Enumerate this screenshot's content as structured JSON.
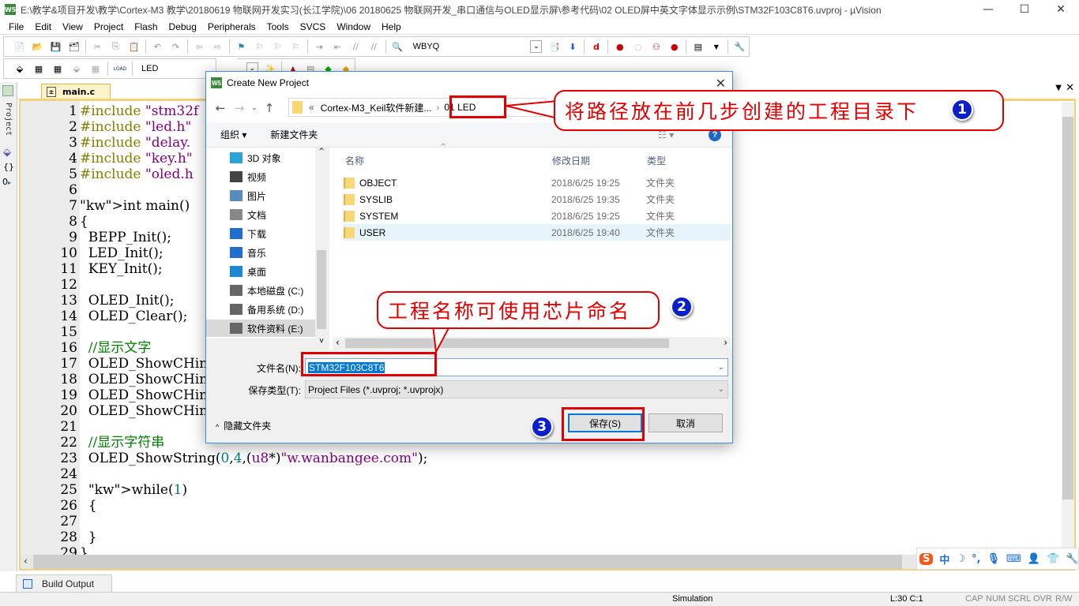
{
  "window": {
    "title": "E:\\教学&项目开发\\教学\\Cortex-M3 教学\\20180619 物联网开发实习(长江学院)\\06 20180625 物联网开发_串口通信与OLED显示屏\\参考代码\\02 OLED屏中英文字体显示示例\\STM32F103C8T6.uvproj - µVision",
    "app_icon": "W5",
    "controls": {
      "minimize": "—",
      "maximize": "☐",
      "close": "✕"
    }
  },
  "menu": [
    "File",
    "Edit",
    "View",
    "Project",
    "Flash",
    "Debug",
    "Peripherals",
    "Tools",
    "SVCS",
    "Window",
    "Help"
  ],
  "toolbar1": {
    "find_value": "WBYQ"
  },
  "toolbar2": {
    "target": "LED",
    "load_label": "LOAD"
  },
  "sidebar": {
    "project_label": "Project"
  },
  "editor": {
    "tab": "main.c",
    "lines": [
      {
        "n": "1",
        "code": "#include \"stm32f"
      },
      {
        "n": "2",
        "code": "#include \"led.h\""
      },
      {
        "n": "3",
        "code": "#include \"delay."
      },
      {
        "n": "4",
        "code": "#include \"key.h\""
      },
      {
        "n": "5",
        "code": "#include \"oled.h"
      },
      {
        "n": "6",
        "code": ""
      },
      {
        "n": "7",
        "code": "int main()"
      },
      {
        "n": "8",
        "code": "{"
      },
      {
        "n": "9",
        "code": "  BEPP_Init();"
      },
      {
        "n": "10",
        "code": "  LED_Init();"
      },
      {
        "n": "11",
        "code": "  KEY_Init();"
      },
      {
        "n": "12",
        "code": ""
      },
      {
        "n": "13",
        "code": "  OLED_Init();"
      },
      {
        "n": "14",
        "code": "  OLED_Clear();"
      },
      {
        "n": "15",
        "code": ""
      },
      {
        "n": "16",
        "code": "  //显示文字"
      },
      {
        "n": "17",
        "code": "  OLED_ShowCHine"
      },
      {
        "n": "18",
        "code": "  OLED_ShowCHine"
      },
      {
        "n": "19",
        "code": "  OLED_ShowCHine"
      },
      {
        "n": "20",
        "code": "  OLED_ShowCHine"
      },
      {
        "n": "21",
        "code": ""
      },
      {
        "n": "22",
        "code": "  //显示字符串"
      },
      {
        "n": "23",
        "code": "  OLED_ShowString(0,4,(u8*)\"w.wanbangee.com\");"
      },
      {
        "n": "24",
        "code": ""
      },
      {
        "n": "25",
        "code": "  while(1)"
      },
      {
        "n": "26",
        "code": "  {"
      },
      {
        "n": "27",
        "code": ""
      },
      {
        "n": "28",
        "code": "  }"
      },
      {
        "n": "29",
        "code": "}"
      }
    ]
  },
  "bottom": {
    "build_output_tab": "Build Output"
  },
  "status": {
    "mode": "Simulation",
    "position": "L:30 C:1",
    "flags": [
      "CAP",
      "NUM",
      "SCRL",
      "OVR",
      "R/W"
    ]
  },
  "dialog": {
    "title": "Create New Project",
    "path": {
      "prefix": "«",
      "parent": "Cortex-M3_Keil软件新建...",
      "current": "01 LED"
    },
    "organize": "组织 ▾",
    "new_folder": "新建文件夹",
    "nav_items": [
      "3D 对象",
      "视频",
      "图片",
      "文档",
      "下载",
      "音乐",
      "桌面",
      "本地磁盘 (C:)",
      "备用系统 (D:)",
      "软件资料 (E:)"
    ],
    "columns": {
      "name": "名称",
      "date": "修改日期",
      "type": "类型"
    },
    "files": [
      {
        "name": "OBJECT",
        "date": "2018/6/25 19:25",
        "type": "文件夹"
      },
      {
        "name": "SYSLIB",
        "date": "2018/6/25 19:35",
        "type": "文件夹"
      },
      {
        "name": "SYSTEM",
        "date": "2018/6/25 19:25",
        "type": "文件夹"
      },
      {
        "name": "USER",
        "date": "2018/6/25 19:40",
        "type": "文件夹"
      }
    ],
    "filename_label": "文件名(N):",
    "filename_value": "STM32F103C8T6",
    "filetype_label": "保存类型(T):",
    "filetype_value": "Project Files (*.uvproj; *.uvprojx)",
    "hide_folders": "隐藏文件夹",
    "save": "保存(S)",
    "cancel": "取消"
  },
  "annotations": {
    "step1": "将路径放在前几步创建的工程目录下",
    "step2": "工程名称可使用芯片命名",
    "n1": "1",
    "n2": "2",
    "n3": "3"
  },
  "ime": {
    "mode": "中"
  }
}
